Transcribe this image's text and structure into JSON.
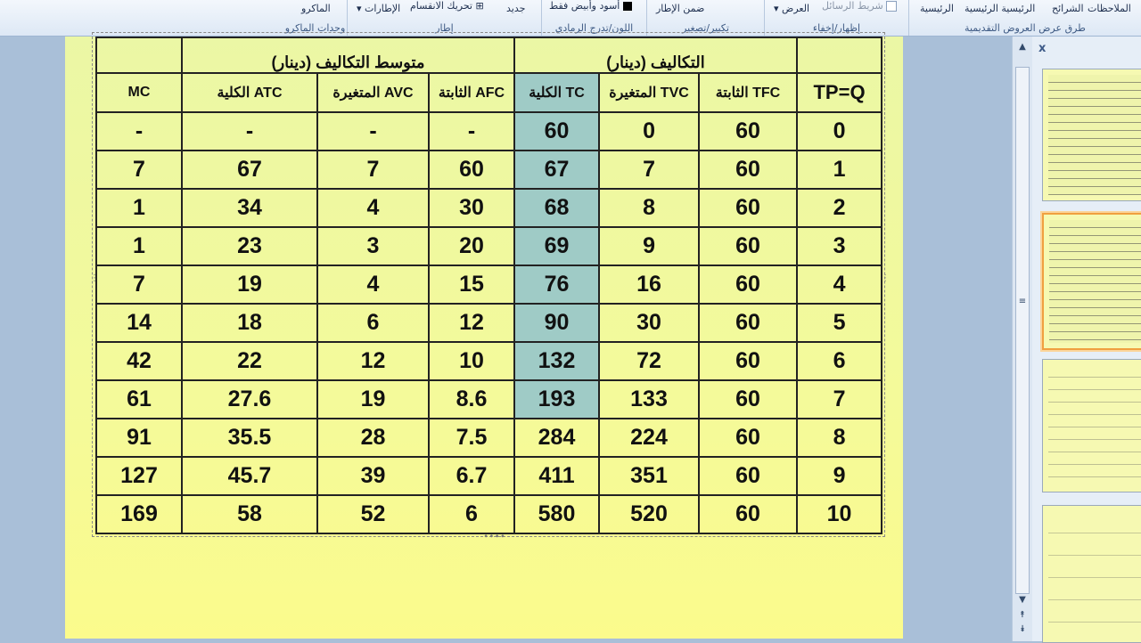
{
  "ribbon": {
    "tabs": [
      "الرئيسية",
      "الرئيسية الرئيسية",
      "الرئيسية",
      "الشرائح",
      "الملاحظات"
    ],
    "group_presentation_views": "طرق عرض العروض التقديمية",
    "show_hide": {
      "label": "إظهار/إخفاء",
      "message_bar": "شريط الرسائل",
      "view": "العرض"
    },
    "zoom": {
      "label": "تكبير/تصغير",
      "fit": "ضمن الإطار"
    },
    "color": {
      "label": "اللون/تدرج الرمادي",
      "bw": "أسود وأبيض فقط"
    },
    "window": {
      "label": "إطار",
      "new": "جديد",
      "move_split": "تحريك الانقسام",
      "frames": "الإطارات"
    },
    "macros": {
      "label": "وحدات الماكرو",
      "macros": "الماكرو"
    }
  },
  "table": {
    "top_row": [
      "",
      "متوسط التكاليف (دينار)",
      "",
      "التكاليف (دينار)",
      ""
    ],
    "headers": [
      "MC",
      "الكلية ATC",
      "المتغيرة AVC",
      "الثابتة AFC",
      "الكلية TC",
      "المتغيرة TVC",
      "الثابتة TFC",
      "TP=Q"
    ],
    "rows": [
      [
        "-",
        "-",
        "-",
        "-",
        "60",
        "0",
        "60",
        "0"
      ],
      [
        "7",
        "67",
        "7",
        "60",
        "67",
        "7",
        "60",
        "1"
      ],
      [
        "1",
        "34",
        "4",
        "30",
        "68",
        "8",
        "60",
        "2"
      ],
      [
        "1",
        "23",
        "3",
        "20",
        "69",
        "9",
        "60",
        "3"
      ],
      [
        "7",
        "19",
        "4",
        "15",
        "76",
        "16",
        "60",
        "4"
      ],
      [
        "14",
        "18",
        "6",
        "12",
        "90",
        "30",
        "60",
        "5"
      ],
      [
        "42",
        "22",
        "12",
        "10",
        "132",
        "72",
        "60",
        "6"
      ],
      [
        "61",
        "27.6",
        "19",
        "8.6",
        "193",
        "133",
        "60",
        "7"
      ],
      [
        "91",
        "35.5",
        "28",
        "7.5",
        "284",
        "224",
        "60",
        "8"
      ],
      [
        "127",
        "45.7",
        "39",
        "6.7",
        "411",
        "351",
        "60",
        "9"
      ],
      [
        "169",
        "58",
        "52",
        "6",
        "580",
        "520",
        "60",
        "10"
      ]
    ]
  },
  "panel": {
    "close": "x"
  },
  "colors": {
    "highlight": "#9fcbc6",
    "slide_bg": "#f4fa9a",
    "ribbon_bg": "#dde8f5"
  }
}
